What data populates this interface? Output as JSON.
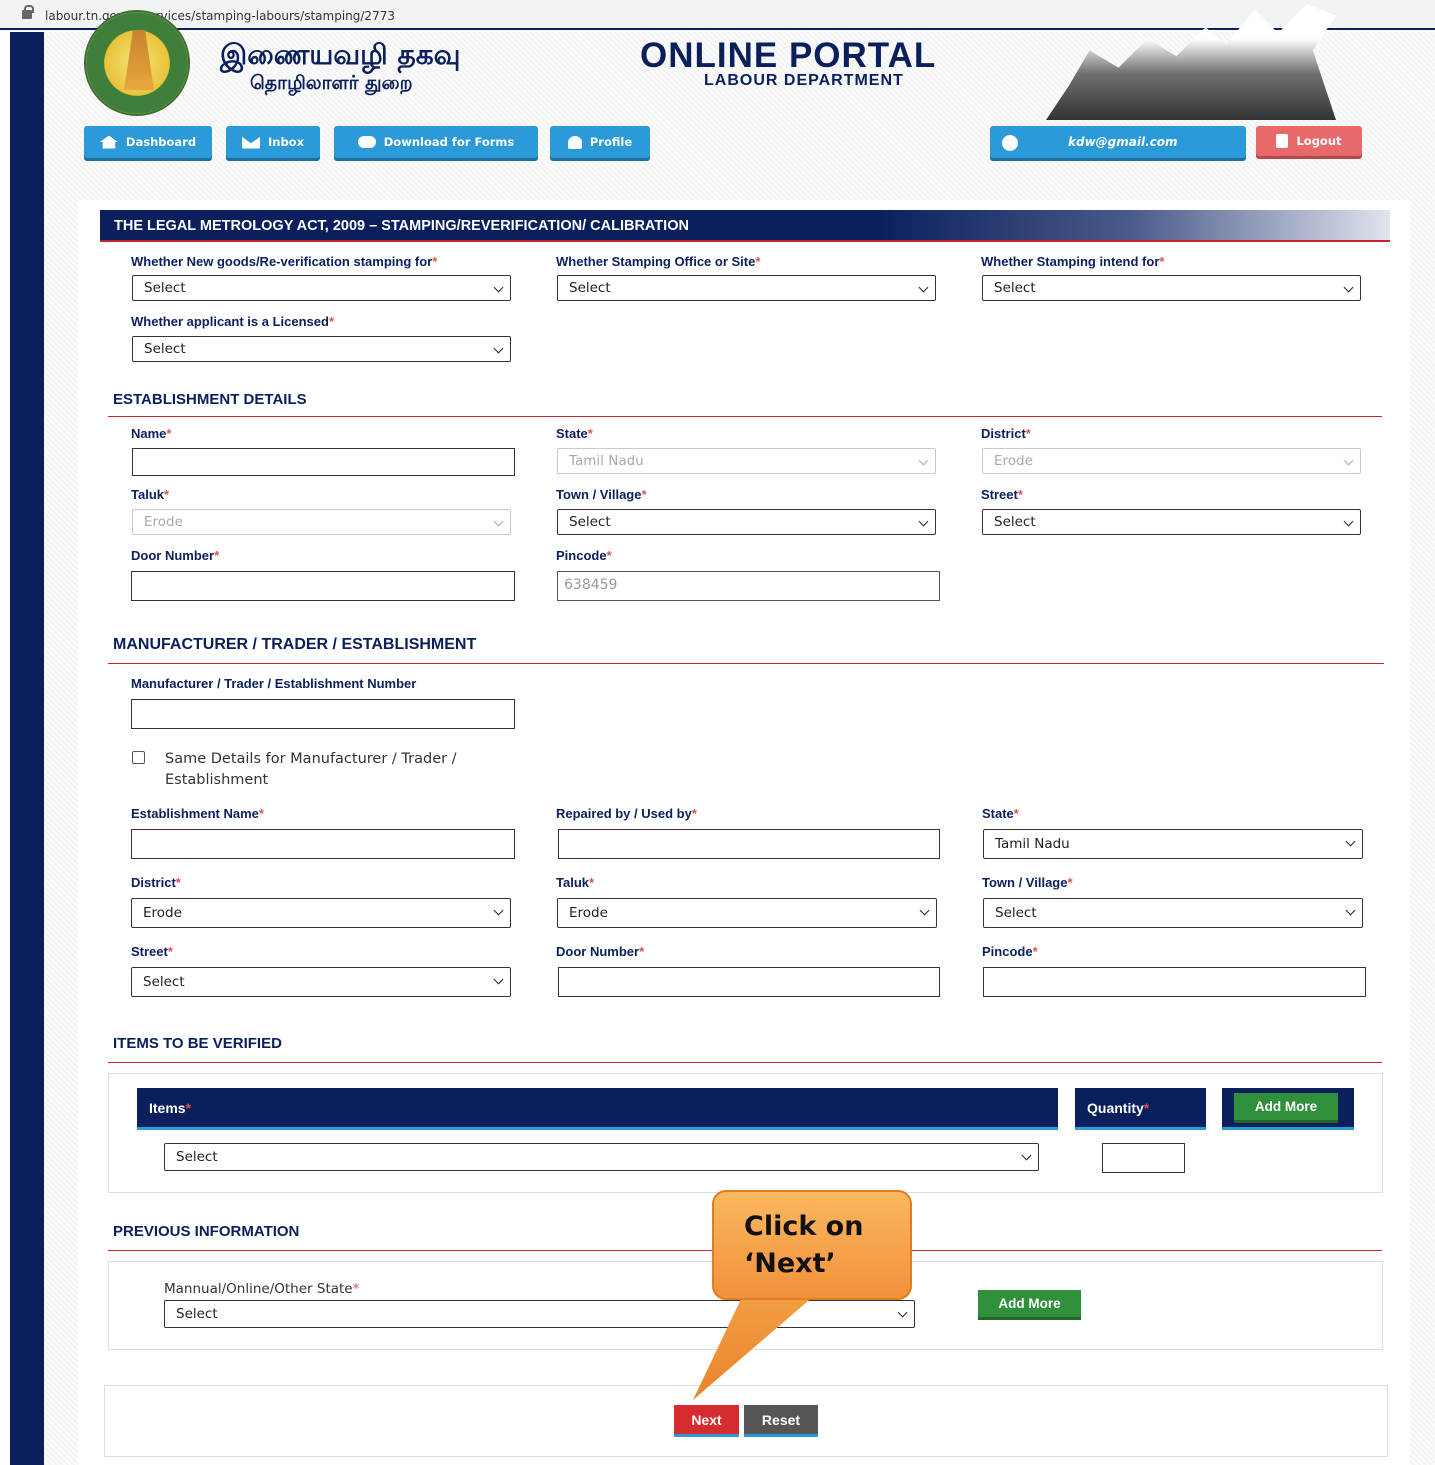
{
  "browser": {
    "url": "labour.tn.gov.in/services/stamping-labours/stamping/2773"
  },
  "header": {
    "tamil_title": "இணையவழி தகவு",
    "tamil_subtitle": "தொழிலாளர் துறை",
    "portal_title": "ONLINE PORTAL",
    "portal_subtitle": "LABOUR DEPARTMENT"
  },
  "nav": {
    "dashboard": "Dashboard",
    "inbox": "Inbox",
    "download": "Download for Forms",
    "profile": "Profile",
    "user_email": "kdw@gmail.com",
    "logout": "Logout"
  },
  "form": {
    "banner": "THE LEGAL METROLOGY ACT, 2009 – STAMPING/REVERIFICATION/ CALIBRATION",
    "top": {
      "new_goods_label": "Whether New goods/Re-verification stamping for",
      "new_goods_value": "Select",
      "office_site_label": "Whether Stamping Office or Site",
      "office_site_value": "Select",
      "intend_label": "Whether Stamping intend for",
      "intend_value": "Select",
      "licensed_label": "Whether applicant is a Licensed",
      "licensed_value": "Select"
    },
    "establishment": {
      "title": "ESTABLISHMENT DETAILS",
      "name_label": "Name",
      "name_value": "",
      "state_label": "State",
      "state_value": "Tamil Nadu",
      "district_label": "District",
      "district_value": "Erode",
      "taluk_label": "Taluk",
      "taluk_value": "Erode",
      "town_label": "Town / Village",
      "town_value": "Select",
      "street_label": "Street",
      "street_value": "Select",
      "door_label": "Door Number",
      "door_value": "",
      "pincode_label": "Pincode",
      "pincode_value": "638459"
    },
    "manufacturer": {
      "title": "MANUFACTURER / TRADER / ESTABLISHMENT",
      "number_label": "Manufacturer / Trader / Establishment Number",
      "number_value": "",
      "same_details_label": "Same Details for Manufacturer / Trader / Establishment",
      "est_name_label": "Establishment Name",
      "repaired_label": "Repaired by / Used by",
      "state_label": "State",
      "state_value": "Tamil Nadu",
      "district_label": "District",
      "district_value": "Erode",
      "taluk_label": "Taluk",
      "taluk_value": "Erode",
      "town_label": "Town / Village",
      "town_value": "Select",
      "street_label": "Street",
      "street_value": "Select",
      "door_label": "Door Number",
      "pincode_label": "Pincode"
    },
    "items": {
      "title": "ITEMS TO BE VERIFIED",
      "items_header": "Items",
      "quantity_header": "Quantity",
      "add_more": "Add More",
      "item_value": "Select"
    },
    "previous": {
      "title": "PREVIOUS INFORMATION",
      "mode_label": "Mannual/Online/Other State",
      "mode_value": "Select",
      "add_more": "Add More"
    },
    "actions": {
      "next": "Next",
      "reset": "Reset"
    },
    "required_mark": "*"
  },
  "callout": {
    "line1": "Click on",
    "line2": "‘Next’"
  },
  "colors": {
    "navy": "#0a1f5c",
    "blue": "#2a9bd8",
    "red": "#d72c2f",
    "green": "#2f8f3a",
    "callout": "#f2913a"
  }
}
